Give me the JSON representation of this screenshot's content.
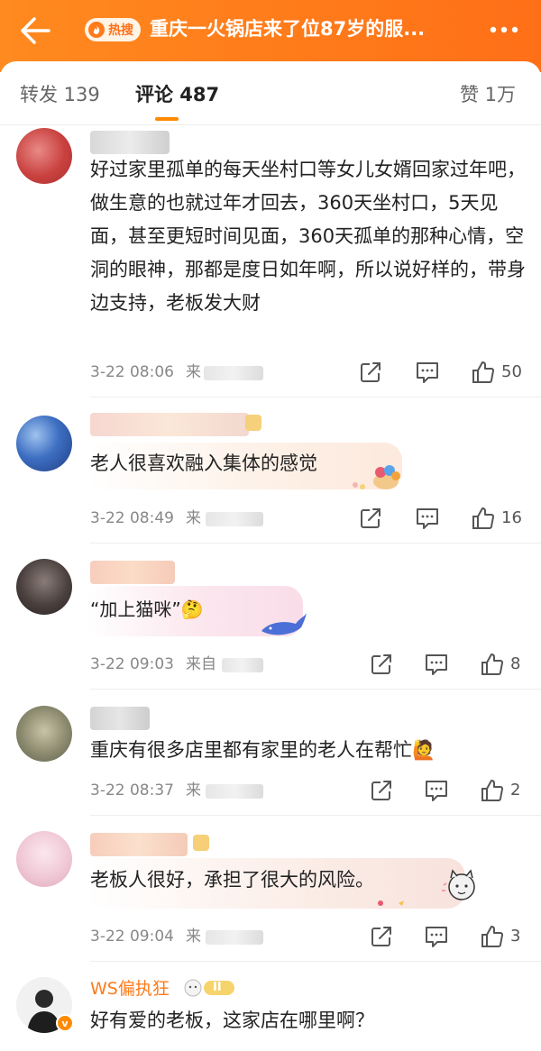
{
  "header": {
    "hot_label": "热搜",
    "title": "重庆一火锅店来了位87岁的服..."
  },
  "tabs": {
    "repost": "转发 139",
    "comments": "评论 487",
    "likes": "赞 1万"
  },
  "comments": [
    {
      "username": "",
      "text": "好过家里孤单的每天坐村口等女儿女婿回家过年吧，做生意的也就过年才回去，360天坐村口，5天见面，甚至更短时间见面，360天孤单的那种心情，空洞的眼神，那都是度日如年啊，所以说好样的，带身边支持，老板发大财",
      "time": "3-22 08:06",
      "source": "来",
      "likes": "50"
    },
    {
      "username": "",
      "text": "老人很喜欢融入集体的感觉",
      "time": "3-22 08:49",
      "source": "来",
      "likes": "16"
    },
    {
      "username": "",
      "text": "“加上猫咪”🤔",
      "time": "3-22 09:03",
      "source": "来自",
      "likes": "8"
    },
    {
      "username": "",
      "text": "重庆有很多店里都有家里的老人在帮忙🙋",
      "time": "3-22 08:37",
      "source": "来",
      "likes": "2"
    },
    {
      "username": "",
      "text": "老板人很好，承担了很大的风险。",
      "time": "3-22 09:04",
      "source": "来",
      "likes": "3"
    },
    {
      "username": "WS偏执狂",
      "level": "II",
      "text": "好有爱的老板，这家店在哪里啊？"
    }
  ],
  "colors": {
    "brand_orange": "#ff8a1f",
    "vip_name": "#ff7a1a",
    "meta_gray": "#888888"
  },
  "icons": [
    "back-arrow-icon",
    "flame-icon",
    "more-dots-icon",
    "repost-icon",
    "comment-icon",
    "thumbs-up-icon"
  ]
}
